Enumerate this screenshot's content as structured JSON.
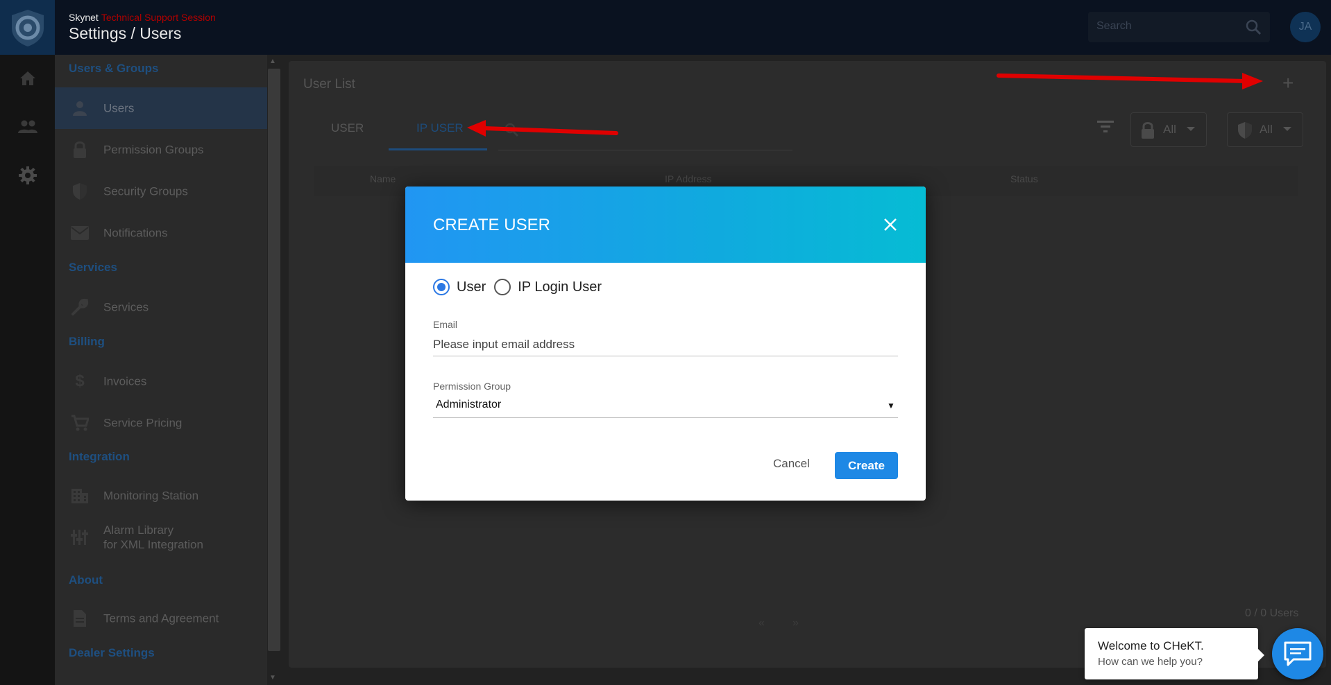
{
  "header": {
    "brand": "Skynet",
    "session": "Technical Support Session",
    "title": "Settings / Users",
    "search_placeholder": "Search",
    "avatar_initials": "JA"
  },
  "sidebar": {
    "sections": {
      "users_groups": "Users & Groups",
      "services": "Services",
      "billing": "Billing",
      "integration": "Integration",
      "about": "About",
      "dealer": "Dealer Settings"
    },
    "items": {
      "users": "Users",
      "permission_groups": "Permission Groups",
      "security_groups": "Security Groups",
      "notifications": "Notifications",
      "services": "Services",
      "invoices": "Invoices",
      "service_pricing": "Service Pricing",
      "monitoring_station": "Monitoring Station",
      "alarm_library_1": "Alarm Library",
      "alarm_library_2": "for XML Integration",
      "terms": "Terms and Agreement"
    }
  },
  "main": {
    "title": "User List",
    "tabs": [
      "USER",
      "IP USER"
    ],
    "active_tab": "IP USER",
    "filter_lock": "All",
    "filter_shield": "All",
    "columns": [
      "Name",
      "IP Address",
      "Status"
    ],
    "pager_prev": "«",
    "pager_next": "»",
    "count": "0 / 0 Users"
  },
  "modal": {
    "title": "CREATE USER",
    "radio_user": "User",
    "radio_ip": "IP Login User",
    "email_label": "Email",
    "email_placeholder": "Please input email address",
    "permission_label": "Permission Group",
    "permission_value": "Administrator",
    "cancel": "Cancel",
    "create": "Create"
  },
  "chat": {
    "title": "Welcome to CHeKT.",
    "subtitle": "How can we help you?"
  },
  "colors": {
    "accent": "#1e88e5",
    "modal_gradient_start": "#2196f3",
    "modal_gradient_end": "#06bcd4",
    "arrow": "#e00000"
  }
}
